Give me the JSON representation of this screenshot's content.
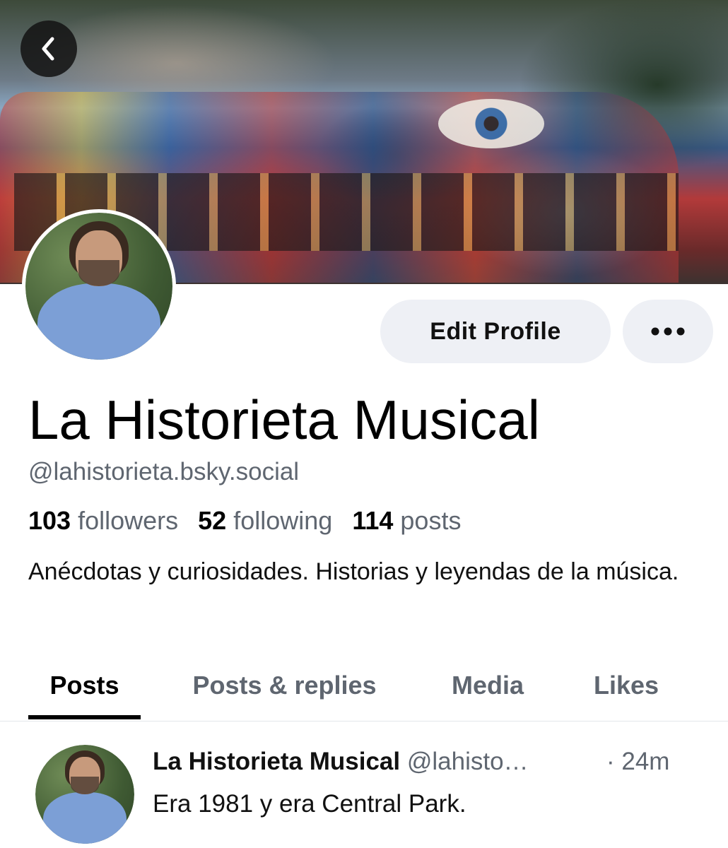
{
  "header": {
    "back_icon": "chevron-left-icon"
  },
  "profile": {
    "display_name": "La Historieta Musical",
    "handle": "@lahistorieta.bsky.social",
    "followers_count": "103",
    "followers_label": "followers",
    "following_count": "52",
    "following_label": "following",
    "posts_count": "114",
    "posts_label": "posts",
    "bio": "Anécdotas y curiosidades. Historias y leyendas de la música.",
    "edit_profile_label": "Edit Profile",
    "more_icon": "more-horizontal-icon"
  },
  "tabs": [
    {
      "label": "Posts",
      "active": true
    },
    {
      "label": "Posts & replies",
      "active": false
    },
    {
      "label": "Media",
      "active": false
    },
    {
      "label": "Likes",
      "active": false
    }
  ],
  "feed": {
    "posts": [
      {
        "author": "La Historieta Musical",
        "handle": "@lahisto…",
        "time": "· 24m",
        "text": "Era 1981 y era Central Park."
      }
    ]
  },
  "colors": {
    "accent_button_bg": "#eef0f5",
    "secondary_text": "#5f6670",
    "primary_text": "#000000"
  }
}
